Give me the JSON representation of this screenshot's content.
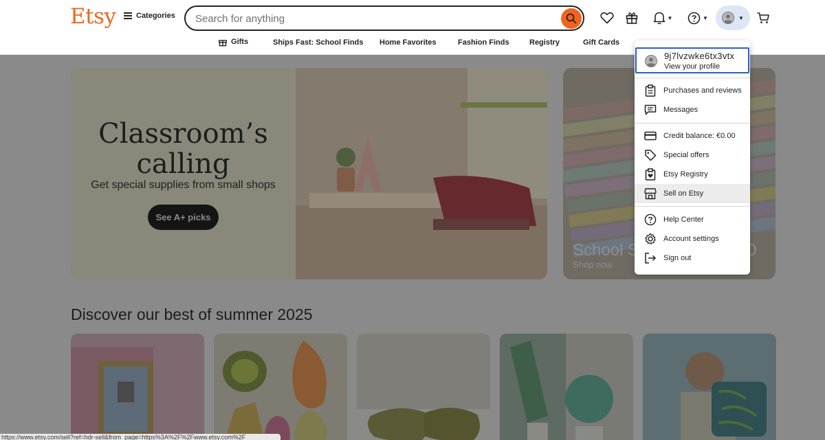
{
  "header": {
    "logo": "Etsy",
    "categories_label": "Categories",
    "search_placeholder": "Search for anything",
    "icons": [
      "heart-icon",
      "gift-icon",
      "bell-icon",
      "help-icon",
      "avatar",
      "cart-icon"
    ]
  },
  "subnav": {
    "items": [
      "Gifts",
      "Ships Fast: School Finds",
      "Home Favorites",
      "Fashion Finds",
      "Registry",
      "Gift Cards"
    ]
  },
  "hero": {
    "title": "Classroom’s calling",
    "subtitle": "Get special supplies from small shops",
    "button": "See A+ picks"
  },
  "side_banner": {
    "title": "School Su",
    "title_suffix": "0",
    "subtitle": "Shop now"
  },
  "discover": {
    "heading": "Discover our best of summer 2025"
  },
  "account_menu": {
    "username": "9j7lvzwke6tx3vtx",
    "profile_link": "View your profile",
    "items": [
      {
        "label": "Purchases and reviews",
        "icon": "clipboard-icon"
      },
      {
        "label": "Messages",
        "icon": "message-icon"
      },
      {
        "label": "Credit balance: €0.00",
        "icon": "credit-card-icon"
      },
      {
        "label": "Special offers",
        "icon": "tag-icon"
      },
      {
        "label": "Etsy Registry",
        "icon": "registry-icon"
      },
      {
        "label": "Sell on Etsy",
        "icon": "shop-icon"
      },
      {
        "label": "Help Center",
        "icon": "help-icon"
      },
      {
        "label": "Account settings",
        "icon": "gear-icon"
      },
      {
        "label": "Sign out",
        "icon": "sign-out-icon"
      }
    ]
  },
  "status_bar": {
    "url": "https://www.etsy.com/sell?ref=hdr-sell&from_page=https%3A%2F%2Fwww.etsy.com%2F"
  },
  "colors": {
    "brand": "#f1641e",
    "focus": "#2a5ec5",
    "overlay": "#8a8a8a"
  }
}
